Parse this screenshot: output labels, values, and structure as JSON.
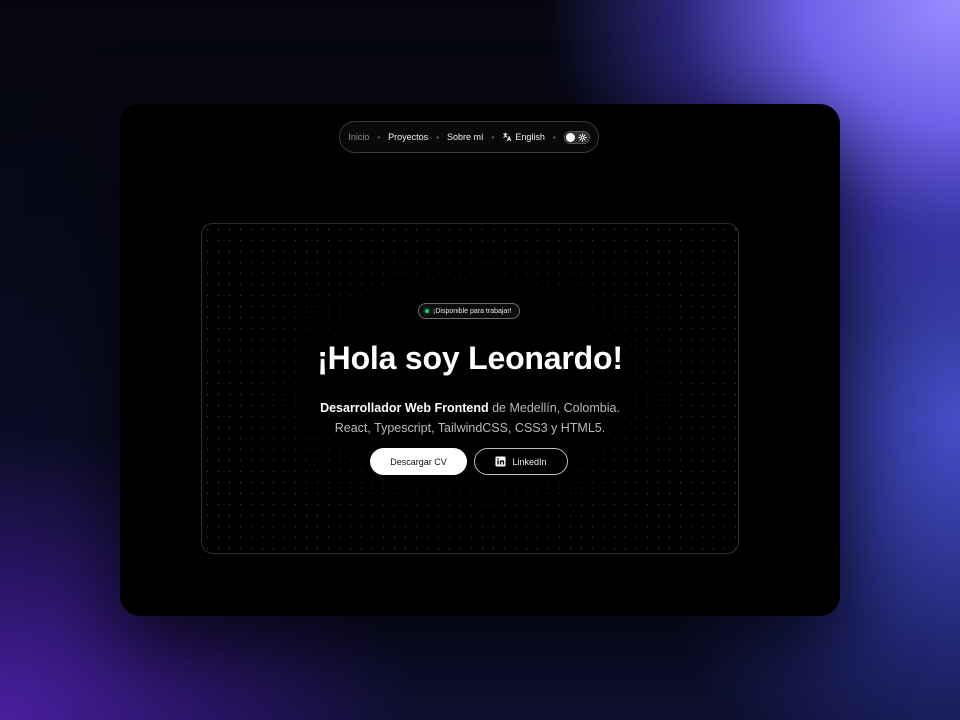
{
  "nav": {
    "items": [
      {
        "label": "Inicio"
      },
      {
        "label": "Proyectos"
      },
      {
        "label": "Sobre mí"
      }
    ],
    "language_label": "English",
    "language_icon": "translate-icon",
    "theme_toggle_icon": "sun-icon"
  },
  "hero": {
    "badge": "¡Disponible para trabajar!",
    "title": "¡Hola soy Leonardo!",
    "subtitle_strong": "Desarrollador Web Frontend",
    "subtitle_rest": " de Medellín, Colombia.",
    "subtitle_line2": "React, Typescript, TailwindCSS, CSS3 y HTML5.",
    "cv_button": "Descargar CV",
    "linkedin_button": "LinkedIn",
    "linkedin_icon": "linkedin-icon"
  },
  "colors": {
    "status_dot": "#22c55e",
    "background_accent": "#7b6cf0"
  }
}
